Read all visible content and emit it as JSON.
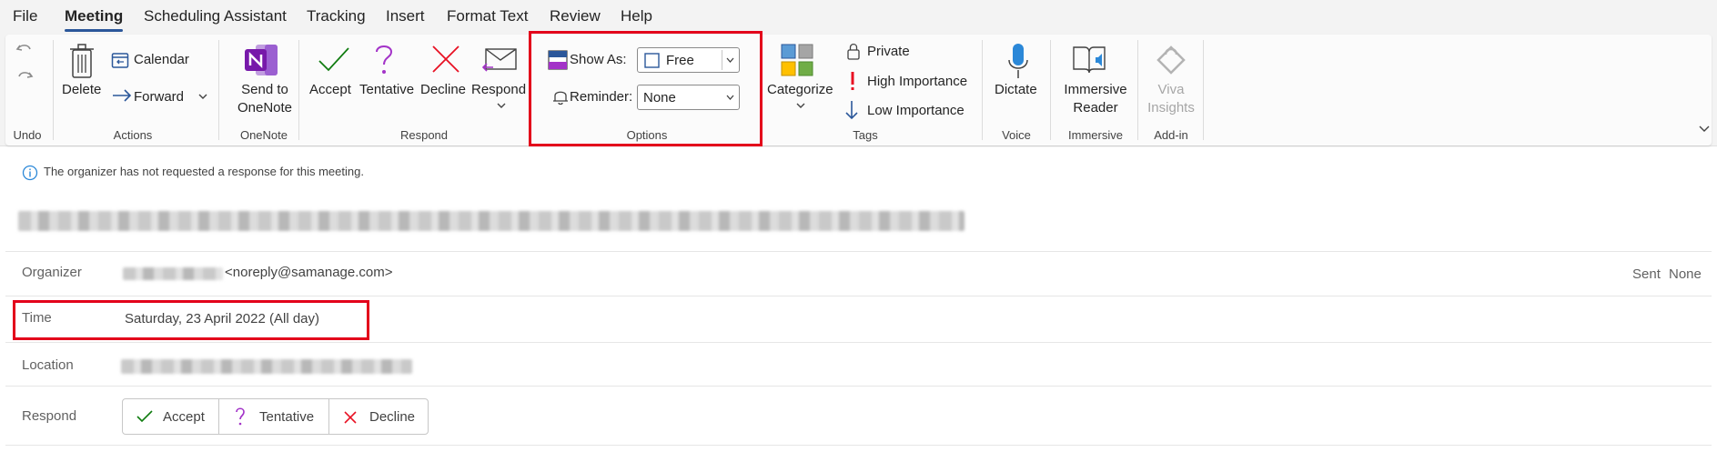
{
  "tabs": [
    "File",
    "Meeting",
    "Scheduling Assistant",
    "Tracking",
    "Insert",
    "Format Text",
    "Review",
    "Help"
  ],
  "active_tab": "Meeting",
  "ribbon": {
    "undo": {
      "label": "Undo"
    },
    "actions": {
      "delete": "Delete",
      "calendar": "Calendar",
      "forward": "Forward",
      "label": "Actions"
    },
    "onenote": {
      "send_line1": "Send to",
      "send_line2": "OneNote",
      "label": "OneNote"
    },
    "respond": {
      "accept": "Accept",
      "tentative": "Tentative",
      "decline": "Decline",
      "respond": "Respond",
      "label": "Respond"
    },
    "options": {
      "show_as_label": "Show As:",
      "show_as_value": "Free",
      "reminder_label": "Reminder:",
      "reminder_value": "None",
      "label": "Options"
    },
    "tags": {
      "categorize": "Categorize",
      "private": "Private",
      "high": "High Importance",
      "low": "Low Importance",
      "label": "Tags"
    },
    "voice": {
      "dictate": "Dictate",
      "label": "Voice"
    },
    "immersive": {
      "line1": "Immersive",
      "line2": "Reader",
      "label": "Immersive"
    },
    "addin": {
      "line1": "Viva",
      "line2": "Insights",
      "label": "Add-in"
    }
  },
  "info_bar": "The organizer has not requested a response for this meeting.",
  "details": {
    "organizer_label": "Organizer",
    "organizer_email": "<noreply@samanage.com>",
    "sent_label": "Sent",
    "sent_value": "None",
    "time_label": "Time",
    "time_value": "Saturday, 23 April 2022 (All day)",
    "location_label": "Location",
    "respond_label": "Respond",
    "respond_accept": "Accept",
    "respond_tentative": "Tentative",
    "respond_decline": "Decline"
  },
  "colors": {
    "highlight": "#e3001b",
    "accent": "#2b579a",
    "decline": "#e81123",
    "accept": "#107c10",
    "tentative": "#a333c8"
  }
}
